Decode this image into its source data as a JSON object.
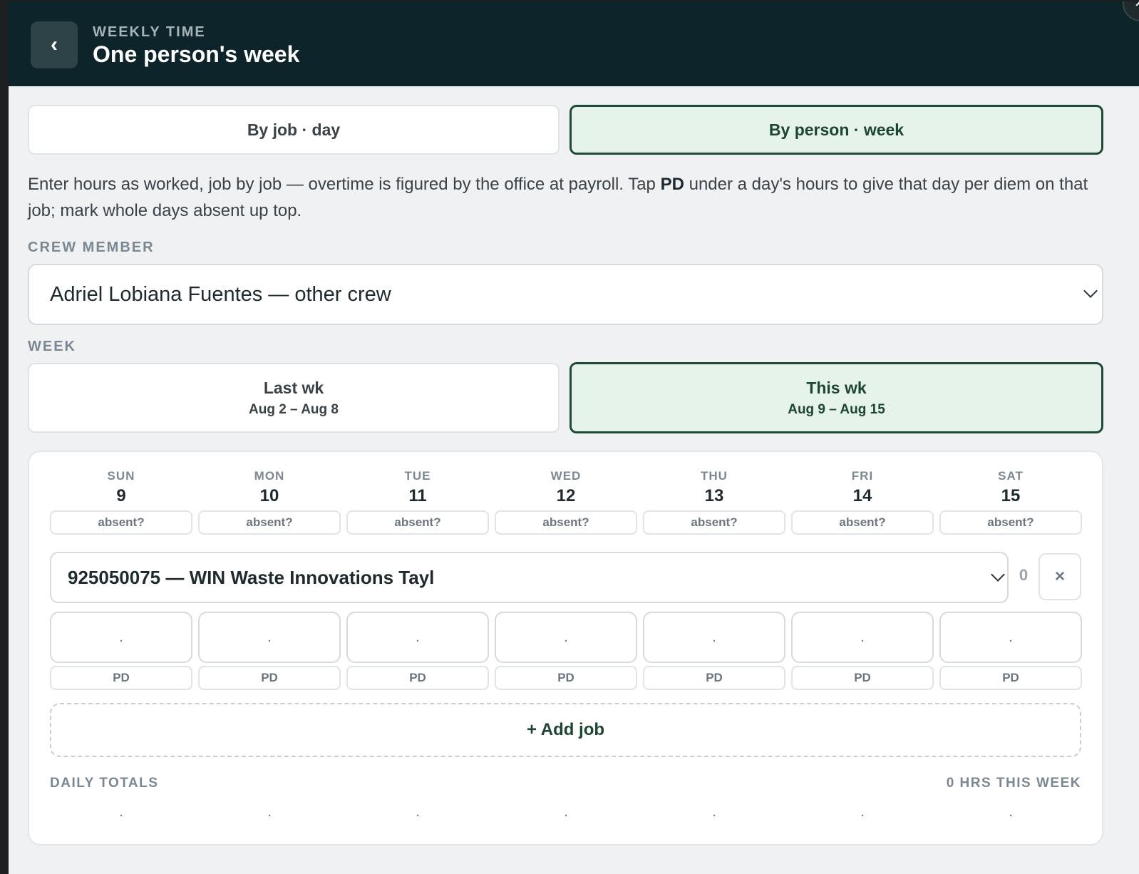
{
  "header": {
    "eyebrow": "WEEKLY TIME",
    "title": "One person's week",
    "back_icon": "‹"
  },
  "view_toggle": {
    "by_job": "By job · day",
    "by_person": "By person · week",
    "active": "by_person"
  },
  "description": {
    "before": "Enter hours as worked, job by job — overtime is figured by the office at payroll. Tap ",
    "bold": "PD",
    "after": " under a day's hours to give that day per diem on that job; mark whole days absent up top."
  },
  "crew_member": {
    "label": "CREW MEMBER",
    "selected": "Adriel Lobiana Fuentes — other crew"
  },
  "week": {
    "label": "WEEK",
    "last": {
      "label": "Last wk",
      "range": "Aug 2 – Aug 8"
    },
    "this": {
      "label": "This wk",
      "range": "Aug 9 – Aug 15"
    },
    "active": "this"
  },
  "days": [
    {
      "name": "SUN",
      "num": "9"
    },
    {
      "name": "MON",
      "num": "10"
    },
    {
      "name": "TUE",
      "num": "11"
    },
    {
      "name": "WED",
      "num": "12"
    },
    {
      "name": "THU",
      "num": "13"
    },
    {
      "name": "FRI",
      "num": "14"
    },
    {
      "name": "SAT",
      "num": "15"
    }
  ],
  "absent_label": "absent?",
  "job": {
    "selected": "925050075 — WIN Waste Innovations Tayl",
    "total": "0",
    "remove_icon": "×",
    "hours": [
      ".",
      ".",
      ".",
      ".",
      ".",
      ".",
      "."
    ],
    "pd_label": "PD"
  },
  "add_job_label": "+ Add job",
  "totals": {
    "label": "DAILY TOTALS",
    "week_total": "0 HRS THIS WEEK",
    "daily": [
      ".",
      ".",
      ".",
      ".",
      ".",
      ".",
      "."
    ]
  },
  "colors": {
    "header_bg": "#0c242a",
    "accent": "#1f4a37",
    "accent_bg": "#e6f3ea",
    "page_bg": "#eff1f3"
  }
}
